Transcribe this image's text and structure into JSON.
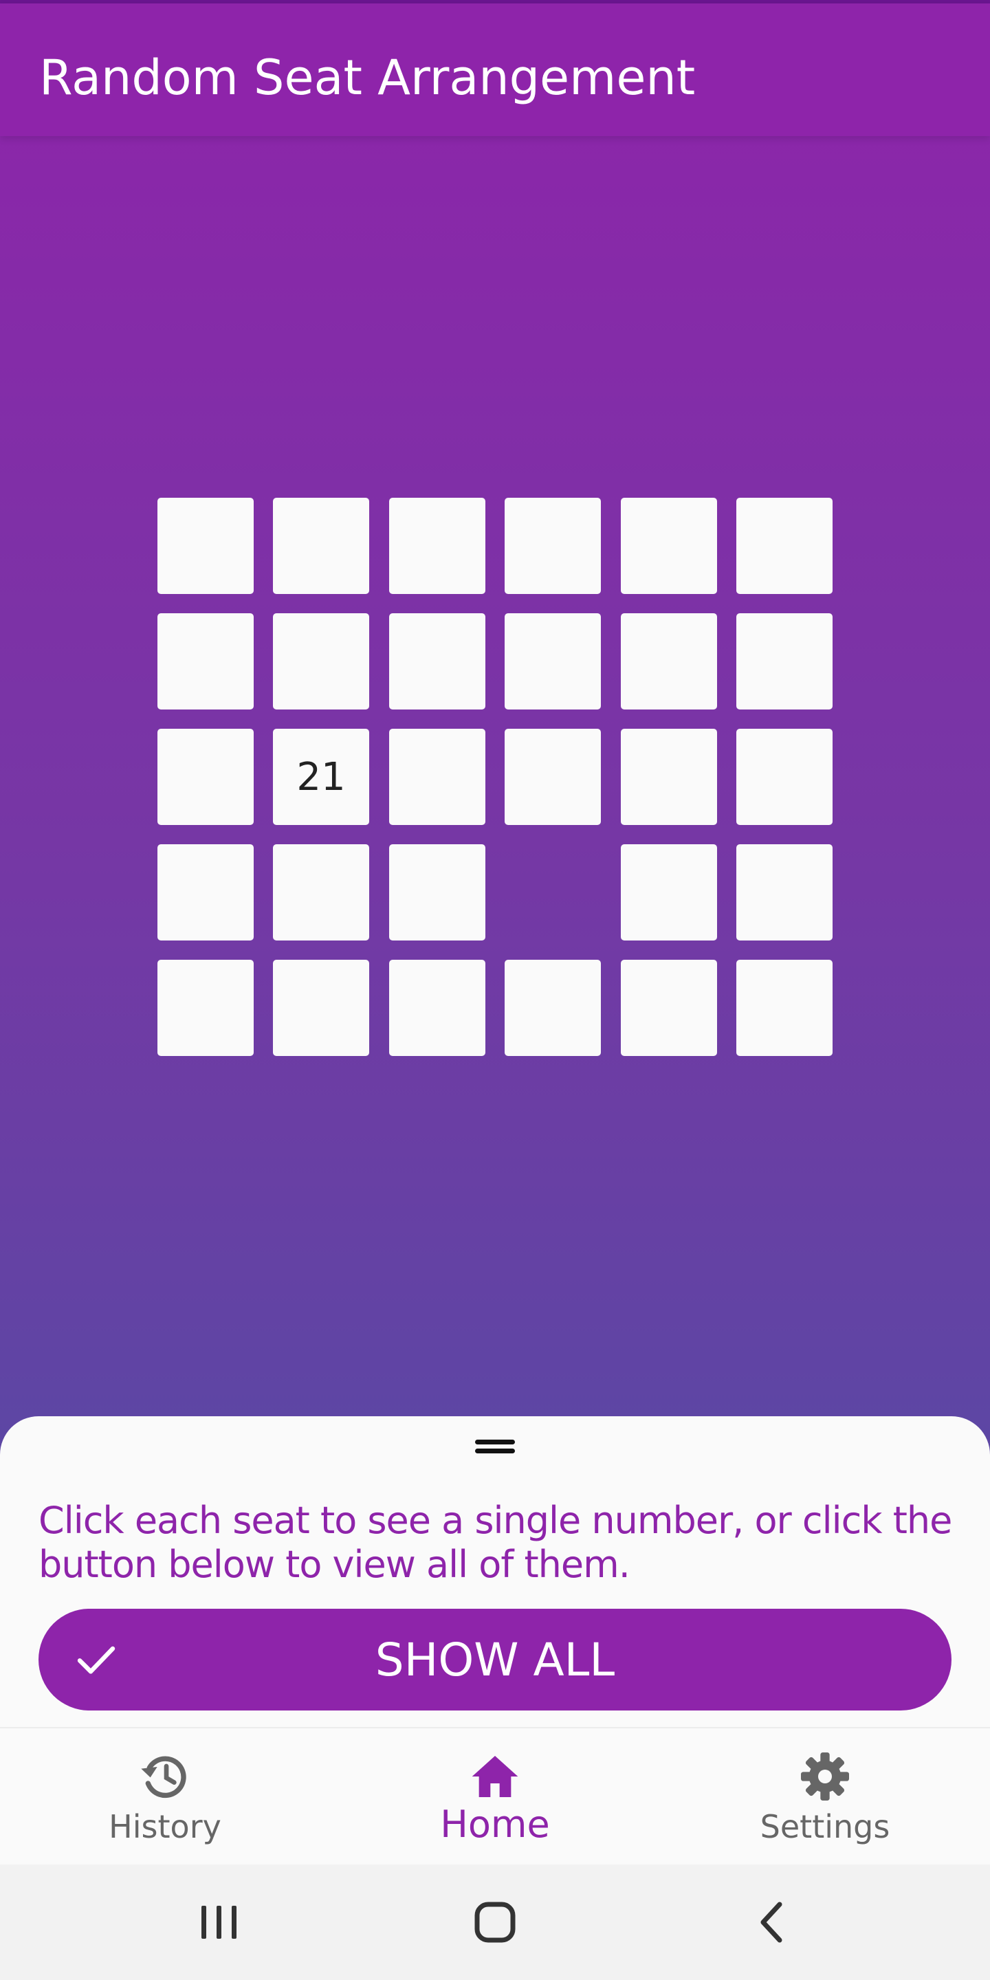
{
  "app": {
    "title": "Random Seat Arrangement",
    "accent_color": "#8e24aa"
  },
  "seating": {
    "rows": 5,
    "cols": 6,
    "empty_positions": [
      [
        3,
        3
      ]
    ],
    "revealed": [
      {
        "row": 2,
        "col": 1,
        "number": "21"
      }
    ]
  },
  "sheet": {
    "instruction": "Click each seat to see a single number, or click the button below to view all of them.",
    "button_label": "SHOW ALL",
    "button_icon": "check-icon"
  },
  "nav": {
    "items": [
      {
        "label": "History",
        "icon": "history-icon",
        "active": false
      },
      {
        "label": "Home",
        "icon": "home-icon",
        "active": true
      },
      {
        "label": "Settings",
        "icon": "gear-icon",
        "active": false
      }
    ]
  },
  "system_nav": {
    "buttons": [
      "recent-apps-icon",
      "home-button-icon",
      "back-icon"
    ]
  }
}
